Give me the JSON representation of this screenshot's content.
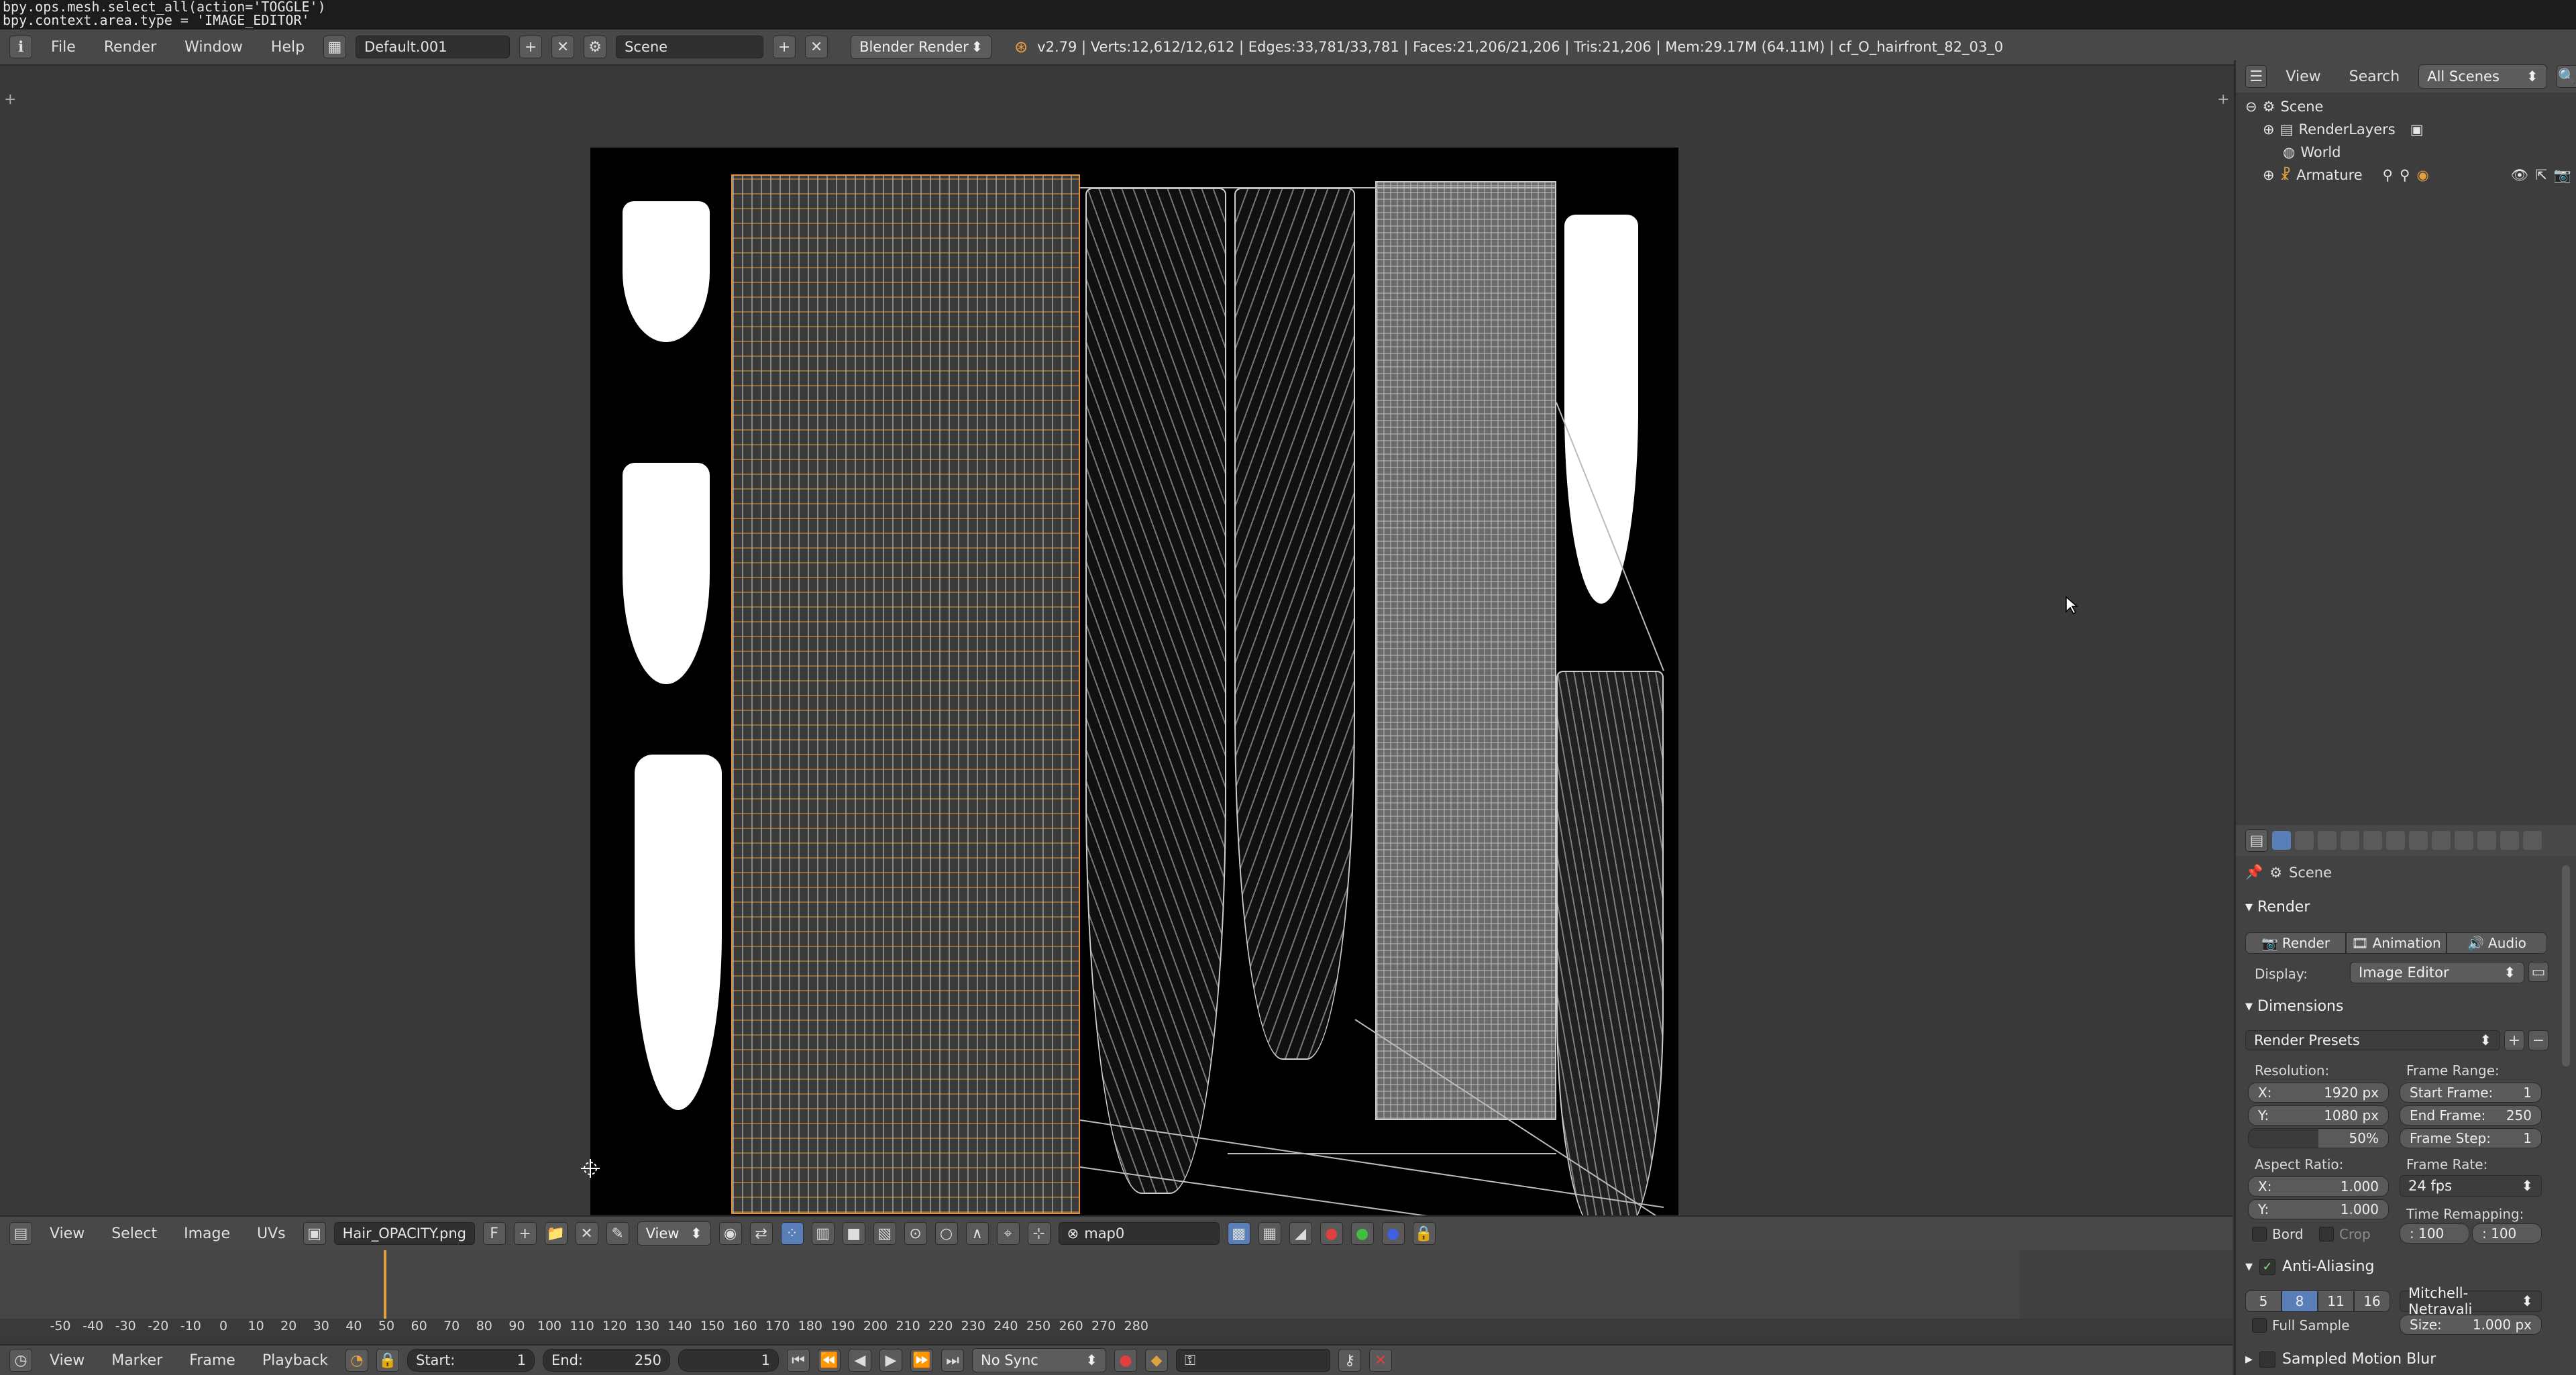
{
  "console": {
    "line1": "bpy.ops.mesh.select_all(action='TOGGLE')",
    "line2": "bpy.context.area.type = 'IMAGE_EDITOR'"
  },
  "topbar": {
    "menus": [
      "File",
      "Render",
      "Window",
      "Help"
    ],
    "screen_layout": "Default.001",
    "scene": "Scene",
    "render_engine": "Blender Render",
    "stats": "v2.79 | Verts:12,612/12,612 | Edges:33,781/33,781 | Faces:21,206/21,206 | Tris:21,206 | Mem:29.17M (64.11M) | cf_O_hairfront_82_03_0"
  },
  "editor_header": {
    "menus": [
      "View",
      "Select",
      "Image",
      "UVs"
    ],
    "image_name": "Hair_OPACITY.png",
    "fake_user": "F",
    "view_label": "View",
    "uv_map": "map0"
  },
  "timeline": {
    "ticks": [
      "-50",
      "-40",
      "-30",
      "-20",
      "-10",
      "0",
      "10",
      "20",
      "30",
      "40",
      "50",
      "60",
      "70",
      "80",
      "90",
      "100",
      "110",
      "120",
      "130",
      "140",
      "150",
      "160",
      "170",
      "180",
      "190",
      "200",
      "210",
      "220",
      "230",
      "240",
      "250",
      "260",
      "270",
      "280"
    ],
    "current_frame_marker": 0,
    "menus": [
      "View",
      "Marker",
      "Frame",
      "Playback"
    ],
    "start_label": "Start:",
    "start_value": "1",
    "end_label": "End:",
    "end_value": "250",
    "current_frame": "1",
    "sync": "No Sync"
  },
  "outliner": {
    "menus": [
      "View",
      "Search"
    ],
    "filter": "All Scenes",
    "items": [
      {
        "label": "Scene",
        "level": 0
      },
      {
        "label": "RenderLayers",
        "level": 1
      },
      {
        "label": "World",
        "level": 1
      },
      {
        "label": "Armature",
        "level": 1
      }
    ]
  },
  "properties": {
    "context": "Scene",
    "render_panel": "Render",
    "render_btn": "Render",
    "animation_btn": "Animation",
    "audio_btn": "Audio",
    "display_label": "Display:",
    "display_value": "Image Editor",
    "dimensions_panel": "Dimensions",
    "render_presets": "Render Presets",
    "resolution_label": "Resolution:",
    "res_x_label": "X:",
    "res_x": "1920 px",
    "res_y_label": "Y:",
    "res_y": "1080 px",
    "res_pct": "50%",
    "frame_range_label": "Frame Range:",
    "start_frame_label": "Start Frame:",
    "start_frame": "1",
    "end_frame_label": "End Frame:",
    "end_frame": "250",
    "frame_step_label": "Frame Step:",
    "frame_step": "1",
    "aspect_label": "Aspect Ratio:",
    "aspect_x_label": "X:",
    "aspect_x": "1.000",
    "aspect_y_label": "Y:",
    "aspect_y": "1.000",
    "frame_rate_label": "Frame Rate:",
    "frame_rate": "24 fps",
    "time_remap_label": "Time Remapping:",
    "remap_old": ": 100",
    "remap_new": ": 100",
    "bord_label": "Bord",
    "crop_label": "Crop",
    "aa_panel": "Anti-Aliasing",
    "aa_samples": [
      "5",
      "8",
      "11",
      "16"
    ],
    "aa_filter": "Mitchell-Netravali",
    "full_sample": "Full Sample",
    "size_label": "Size:",
    "size_value": "1.000 px",
    "motion_blur_panel": "Sampled Motion Blur"
  }
}
